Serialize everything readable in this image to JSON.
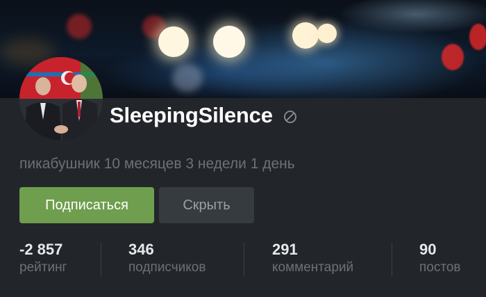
{
  "profile": {
    "username": "SleepingSilence",
    "status_icon": "ban-icon",
    "since": "пикабушник 10 месяцев 3 недели 1 день"
  },
  "actions": {
    "subscribe_label": "Подписаться",
    "hide_label": "Скрыть"
  },
  "stats": [
    {
      "value": "-2 857",
      "label": "рейтинг"
    },
    {
      "value": "346",
      "label": "подписчиков"
    },
    {
      "value": "291",
      "label": "комментарий"
    },
    {
      "value": "90",
      "label": "постов"
    }
  ],
  "colors": {
    "background": "#22262a",
    "subscribe_button": "#6f9e4e",
    "hide_button": "#363b40",
    "muted_text": "#6b7178"
  }
}
